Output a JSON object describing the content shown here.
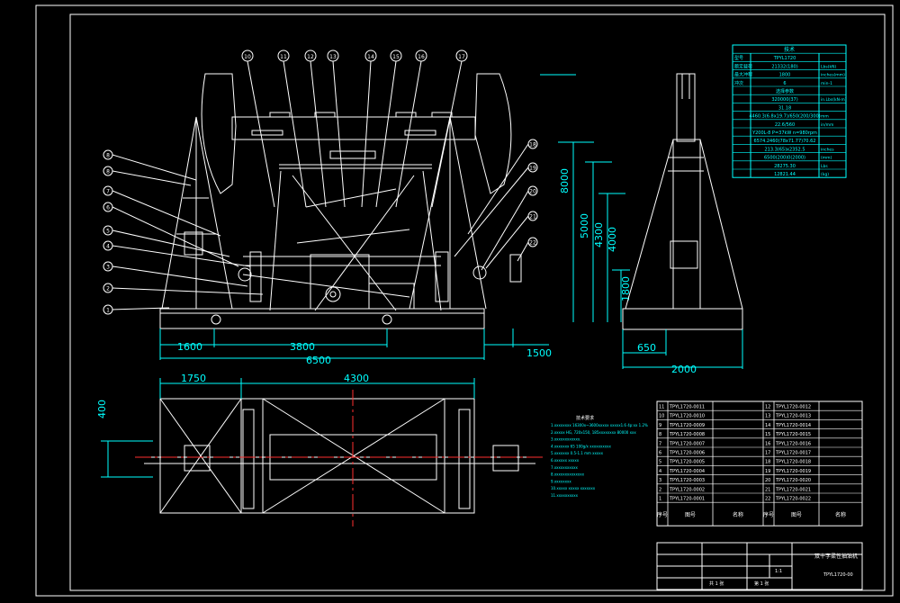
{
  "dimensions": {
    "d1600": "1600",
    "d3800": "3800",
    "d6500": "6500",
    "d1500": "1500",
    "d8000": "8000",
    "d5000": "5000",
    "d4300v": "4300",
    "d4000": "4000",
    "d1800": "1800",
    "d650": "650",
    "d2000": "2000",
    "d1750": "1750",
    "d4300": "4300",
    "d400": "400"
  },
  "balloons": [
    "10",
    "11",
    "12",
    "13",
    "14",
    "15",
    "16",
    "17"
  ],
  "left_callouts": [
    "8",
    "8",
    "7",
    "6",
    "5",
    "4",
    "3",
    "2",
    "1"
  ],
  "right_callouts": [
    "18",
    "19",
    "20",
    "21",
    "22"
  ],
  "spec_table": {
    "title": "技术",
    "rows": [
      [
        "型号",
        "TPYL1720",
        ""
      ],
      [
        "额定载荷",
        "21332(180)",
        "Lbs(kN)"
      ],
      [
        "最大冲程",
        "1800",
        "inches(mm)"
      ],
      [
        "冲次",
        "6",
        "min-1"
      ],
      [
        "",
        "选择参数",
        ""
      ],
      [
        "",
        "320000(37)",
        "in.Lbs(kN·m)"
      ],
      [
        "",
        "31.18",
        ""
      ],
      [
        "",
        "4460.3(6.8x19.7)/650(200/300)",
        "mm"
      ],
      [
        "",
        "22.6/560",
        "in/mm"
      ],
      [
        "",
        "Y200L-8  P=37kW  n=980rpm",
        ""
      ],
      [
        "",
        "6574.2460(78x71.77)70.62",
        ""
      ],
      [
        "",
        "213.3(65)x2352.5",
        "inches"
      ],
      [
        "",
        "6500(200)0(2000)",
        "(mm)"
      ],
      [
        "",
        "28275.30",
        "Lbs"
      ],
      [
        "",
        "12821.44",
        "(kg)"
      ]
    ]
  },
  "bom": {
    "rows": [
      [
        "11",
        "TPYL1720-0011",
        "",
        "12",
        "TPYL1720-0012",
        ""
      ],
      [
        "10",
        "TPYL1720-0010",
        "",
        "13",
        "TPYL1720-0013",
        ""
      ],
      [
        "9",
        "TPYL1720-0009",
        "",
        "14",
        "TPYL1720-0014",
        ""
      ],
      [
        "8",
        "TPYL1720-0008",
        "",
        "15",
        "TPYL1720-0015",
        ""
      ],
      [
        "7",
        "TPYL1720-0007",
        "",
        "16",
        "TPYL1720-0016",
        ""
      ],
      [
        "6",
        "TPYL1720-0006",
        "",
        "17",
        "TPYL1720-0017",
        ""
      ],
      [
        "5",
        "TPYL1720-0005",
        "",
        "18",
        "TPYL1720-0018",
        ""
      ],
      [
        "4",
        "TPYL1720-0004",
        "",
        "19",
        "TPYL1720-0019",
        ""
      ],
      [
        "3",
        "TPYL1720-0003",
        "",
        "20",
        "TPYL1720-0020",
        ""
      ],
      [
        "2",
        "TPYL1720-0002",
        "",
        "21",
        "TPYL1720-0021",
        ""
      ],
      [
        "1",
        "TPYL1720-0001",
        "",
        "22",
        "TPYL1720-0022",
        ""
      ]
    ],
    "header": [
      "序号",
      "图号",
      "名称",
      "序号",
      "图号",
      "名称"
    ]
  },
  "notes": {
    "title": "技术要求",
    "lines": [
      "1.xxxxxxxx 16300x~3600xxxxx xxxxx1.6 4p:xx 1.2%",
      "2.xxxxx HG, 720x150, 185xxxxxxxx 80000 xxx",
      "3.xxxxxxxxxxxx.",
      "4.xxxxxxx 65 100g/x xxxxxxxxxx",
      "5.xxxxxxx 0.5-1.1 mm xxxxx",
      "6.xxxxxx xxxxx",
      "7.xxxxxxxxxxx",
      "8.xxxxxxxxxxxxxx",
      "9.xxxxxxxx",
      "10.xxxxx xxxxx xxxxxxx",
      "11.xxxxxxxxxx"
    ]
  },
  "title_block": {
    "drawing_name": "双十字柔性抽油机",
    "drawing_no": "TPYL1720-00",
    "scale": "1:1",
    "sheet": "第 1 张",
    "sheets": "共 1 张"
  },
  "colors": {
    "line": "#ffffff",
    "dim": "#00ffff",
    "center": "#ff3030",
    "balloon": "#ffffff"
  }
}
